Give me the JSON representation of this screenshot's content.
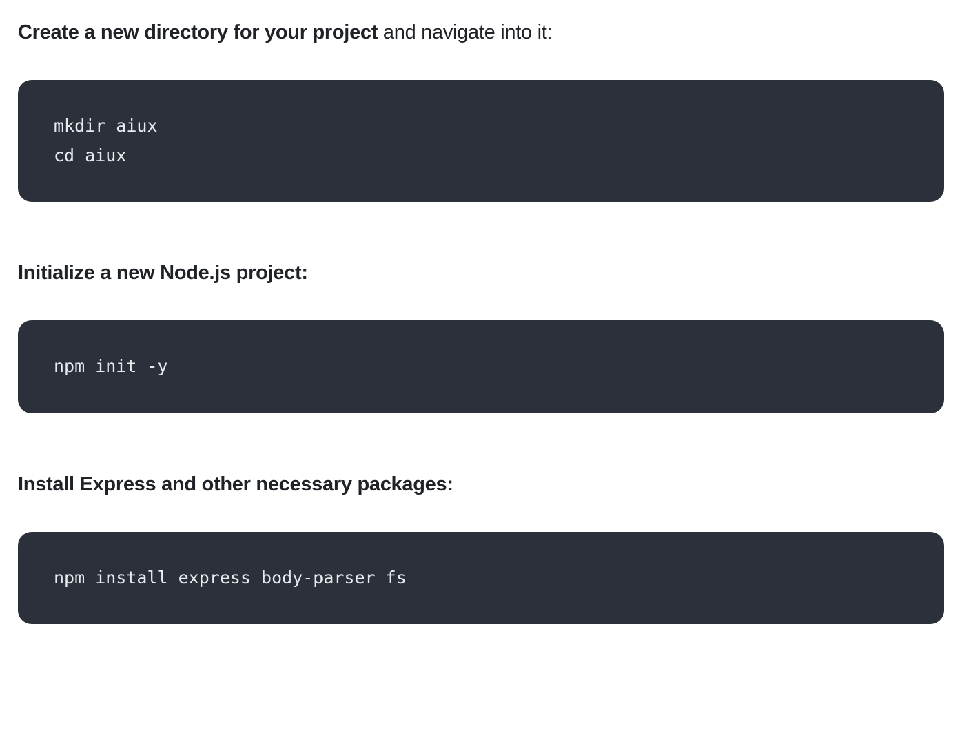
{
  "steps": [
    {
      "heading_bold": "Create a new directory for your project",
      "heading_rest": " and navigate into it:",
      "code": "mkdir aiux\ncd aiux"
    },
    {
      "heading_bold": "Initialize a new Node.js project:",
      "heading_rest": "",
      "code": "npm init -y"
    },
    {
      "heading_bold": "Install Express and other necessary packages:",
      "heading_rest": "",
      "code": "npm install express body-parser fs"
    }
  ]
}
